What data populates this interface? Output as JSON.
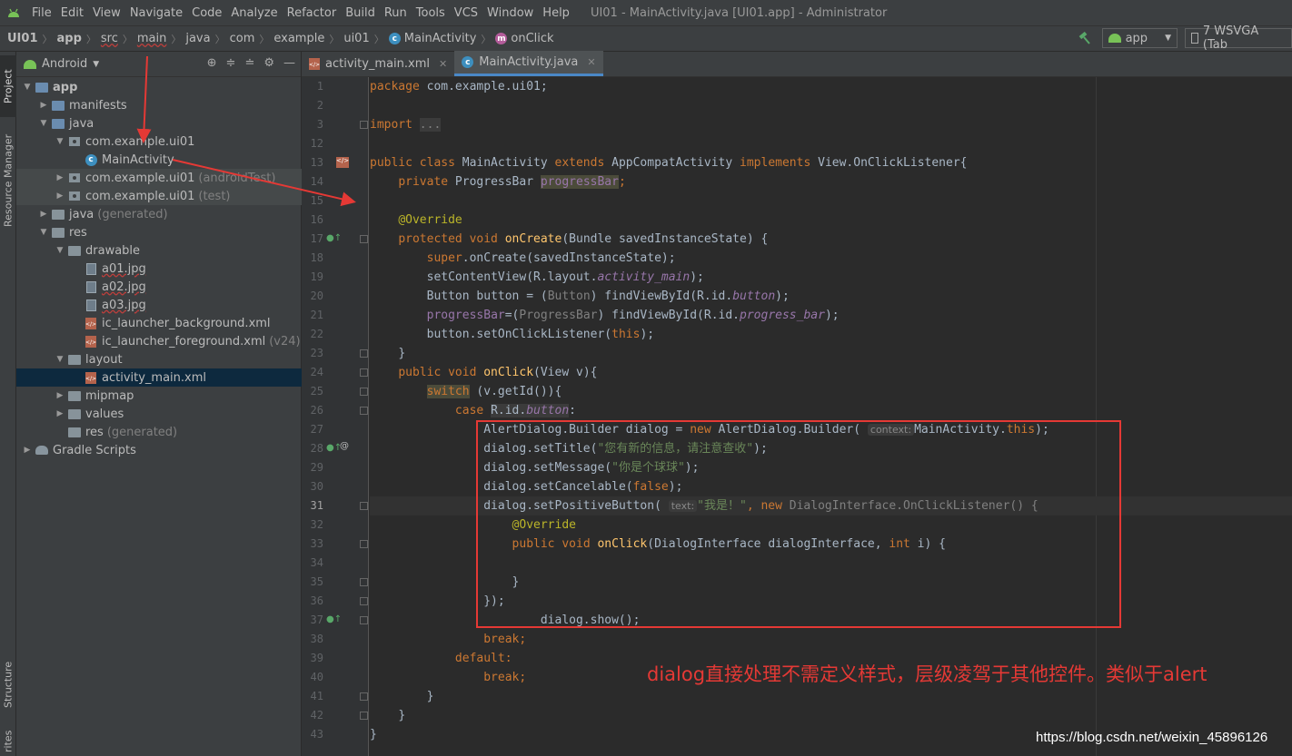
{
  "menubar": {
    "items": [
      "File",
      "Edit",
      "View",
      "Navigate",
      "Code",
      "Analyze",
      "Refactor",
      "Build",
      "Run",
      "Tools",
      "VCS",
      "Window",
      "Help"
    ],
    "window_title": "UI01 - MainActivity.java [UI01.app] - Administrator"
  },
  "navbar": {
    "crumbs": [
      "UI01",
      "app",
      "src",
      "main",
      "java",
      "com",
      "example",
      "ui01",
      "MainActivity",
      "onClick"
    ],
    "run_config": "app",
    "device": "7  WSVGA (Tab"
  },
  "toolstrip": {
    "project": "Project",
    "resource_manager": "Resource Manager",
    "structure": "Structure",
    "favorites": "rites"
  },
  "project_panel": {
    "view": "Android",
    "tree": [
      {
        "label": "app",
        "muted": ""
      },
      {
        "label": "manifests",
        "muted": ""
      },
      {
        "label": "java",
        "muted": ""
      },
      {
        "label": "com.example.ui01",
        "muted": ""
      },
      {
        "label": "MainActivity",
        "muted": ""
      },
      {
        "label": "com.example.ui01",
        "muted": "(androidTest)"
      },
      {
        "label": "com.example.ui01",
        "muted": "(test)"
      },
      {
        "label": "java",
        "muted": "(generated)"
      },
      {
        "label": "res",
        "muted": ""
      },
      {
        "label": "drawable",
        "muted": ""
      },
      {
        "label": "a01.jpg",
        "muted": ""
      },
      {
        "label": "a02.jpg",
        "muted": ""
      },
      {
        "label": "a03.jpg",
        "muted": ""
      },
      {
        "label": "ic_launcher_background.xml",
        "muted": ""
      },
      {
        "label": "ic_launcher_foreground.xml",
        "muted": "(v24)"
      },
      {
        "label": "layout",
        "muted": ""
      },
      {
        "label": "activity_main.xml",
        "muted": ""
      },
      {
        "label": "mipmap",
        "muted": ""
      },
      {
        "label": "values",
        "muted": ""
      },
      {
        "label": "res",
        "muted": "(generated)"
      },
      {
        "label": "Gradle Scripts",
        "muted": ""
      }
    ]
  },
  "editor": {
    "tabs": [
      "activity_main.xml",
      "MainActivity.java"
    ],
    "line_numbers": [
      "1",
      "2",
      "3",
      "12",
      "13",
      "14",
      "15",
      "16",
      "17",
      "18",
      "19",
      "20",
      "21",
      "22",
      "23",
      "24",
      "25",
      "26",
      "27",
      "28",
      "29",
      "30",
      "31",
      "32",
      "33",
      "34",
      "35",
      "36",
      "37",
      "38",
      "39",
      "40",
      "41",
      "42",
      "43"
    ],
    "code": {
      "l1_pkg": "package",
      "l1_name": " com.example.ui01;",
      "l3_import": "import",
      "l3_dots": "...",
      "l13_public": "public class",
      "l13_name": " MainActivity ",
      "l13_extends": "extends",
      "l13_super": " AppCompatActivity ",
      "l13_impl": "implements",
      "l13_iface": " View.OnClickListener{",
      "l14_private": "private",
      "l14_type": " ProgressBar ",
      "l14_field": "progressBar",
      "l14_semi": ";",
      "l16_ann": "@Override",
      "l17_mod": "protected void",
      "l17_fn": "onCreate",
      "l17_rest": "(Bundle savedInstanceState) {",
      "l18_super": "super",
      "l18_rest": ".onCreate(savedInstanceState);",
      "l19_a": "setContentView(R.layout.",
      "l19_b": "activity_main",
      "l19_c": ");",
      "l20_a": "Button button = (",
      "l20_b": "Button",
      "l20_c": ") findViewById(R.id.",
      "l20_d": "button",
      "l20_e": ");",
      "l21_a": "progressBar",
      "l21_b": "=(",
      "l21_c": "ProgressBar",
      "l21_d": ") findViewById(R.id.",
      "l21_e": "progress_bar",
      "l21_f": ");",
      "l22_a": "button.setOnClickListener(",
      "l22_b": "this",
      "l22_c": ");",
      "l23": "}",
      "l24_mod": "public void",
      "l24_fn": "onClick",
      "l24_rest": "(View v){",
      "l25_sw": "switch",
      "l25_rest": " (v.getId()){",
      "l26_case": "case",
      "l26_a": "R.id.",
      "l26_b": "button",
      "l26_c": ":",
      "l27_a": "AlertDialog.Builder dialog = ",
      "l27_new": "new",
      "l27_b": " AlertDialog.Builder(",
      "l27_hint": "context:",
      "l27_c": "MainActivity.",
      "l27_this": "this",
      "l27_d": ");",
      "l28_a": "dialog.setTitle(",
      "l28_str": "\"您有新的信息，请注意查收\"",
      "l28_b": ");",
      "l29_a": "dialog.setMessage(",
      "l29_str": "\"你是个球球\"",
      "l29_b": ");",
      "l30_a": "dialog.setCancelable(",
      "l30_false": "false",
      "l30_b": ");",
      "l31_a": "dialog.setPositiveButton(",
      "l31_hint": "text:",
      "l31_str": "\"我是！\"",
      "l31_b": ", ",
      "l31_new": "new",
      "l31_c": " DialogInterface.OnClickListener() {",
      "l32_ann": "@Override",
      "l33_mod": "public void",
      "l33_fn": "onClick",
      "l33_a": "(DialogInterface dialogInterface, ",
      "l33_int": "int",
      "l33_b": " i) {",
      "l35": "}",
      "l36": "});",
      "l37": "dialog.show();",
      "l38": "break;",
      "l39": "default:",
      "l40": "break;",
      "l41": "}",
      "l42": "}",
      "l43": "}"
    }
  },
  "annotation": "dialog直接处理不需定义样式，层级凌驾于其他控件。类似于alert",
  "watermark": "https://blog.csdn.net/weixin_45896126",
  "colors": {
    "annotation_red": "#e53935",
    "accent_blue": "#4a88c7"
  }
}
